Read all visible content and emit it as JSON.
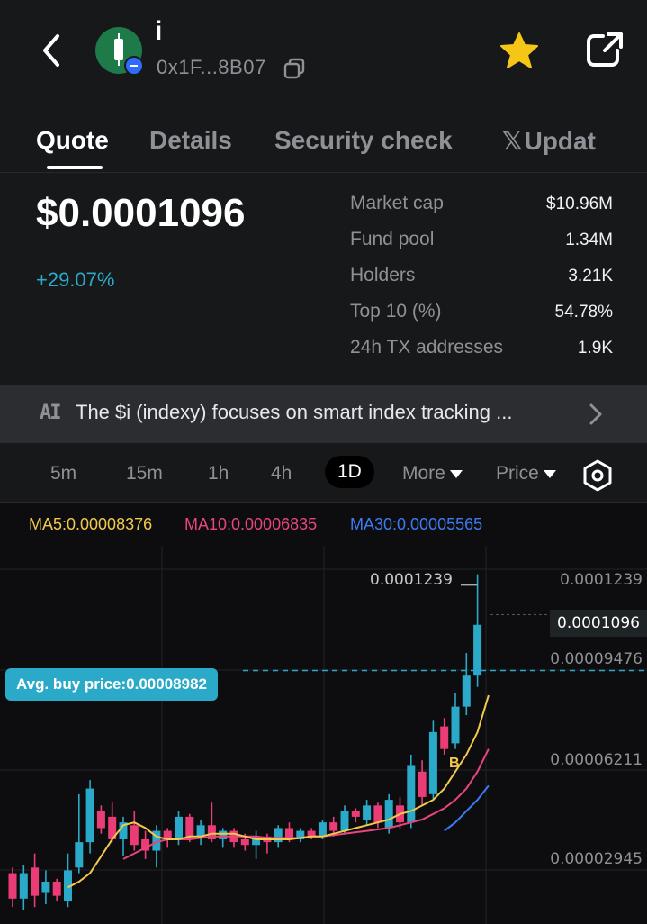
{
  "header": {
    "token_symbol": "i",
    "address": "0x1F...8B07"
  },
  "tabs": [
    {
      "label": "Quote",
      "active": true
    },
    {
      "label": "Details",
      "active": false
    },
    {
      "label": "Security check",
      "active": false
    },
    {
      "label": "Updat",
      "active": false
    }
  ],
  "quote": {
    "price": "$0.0001096",
    "change": "+29.07%",
    "stats": [
      {
        "label": "Market cap",
        "value": "$10.96M"
      },
      {
        "label": "Fund pool",
        "value": "1.34M"
      },
      {
        "label": "Holders",
        "value": "3.21K"
      },
      {
        "label": "Top 10 (%)",
        "value": "54.78%"
      },
      {
        "label": "24h TX addresses",
        "value": "1.9K"
      }
    ]
  },
  "ai_summary": {
    "icon_text": "AI",
    "text": "The $i (indexy) focuses on smart index tracking ..."
  },
  "timeframes": [
    "5m",
    "15m",
    "1h",
    "4h",
    "1D"
  ],
  "timeframe_active": "1D",
  "dropdowns": {
    "more": "More",
    "price": "Price"
  },
  "ma": {
    "ma5": "MA5:0.00008376",
    "ma10": "MA10:0.00006835",
    "ma30": "MA30:0.00005565"
  },
  "colors": {
    "up": "#2aa9c9",
    "down": "#ea3d78",
    "ma5": "#f2c94c",
    "ma10": "#e8457c",
    "ma30": "#3d7bf2",
    "star": "#f5c518",
    "brand": "#1f7a4a"
  },
  "chart_data": {
    "type": "candlestick",
    "y_axis_labels": [
      "0.0001239",
      "0.00009476",
      "0.00006211",
      "0.00002945"
    ],
    "current_price_label": "0.0001096",
    "high_label": "0.0001239",
    "avg_buy_price_label": "Avg. buy price:0.00008982",
    "marker_label": "B",
    "avg_buy_price": 8.982e-05,
    "current_price": 0.0001096,
    "ylim": [
      0.0,
      0.000134
    ],
    "candles": [
      {
        "o": 1.8e-05,
        "c": 9e-06,
        "h": 2e-05,
        "l": 6e-06
      },
      {
        "o": 9e-06,
        "c": 1.8e-05,
        "h": 2.1e-05,
        "l": 5e-06
      },
      {
        "o": 2e-05,
        "c": 1e-05,
        "h": 2.5e-05,
        "l": 6e-06
      },
      {
        "o": 1.1e-05,
        "c": 1.5e-05,
        "h": 1.9e-05,
        "l": 7e-06
      },
      {
        "o": 1.5e-05,
        "c": 1e-05,
        "h": 1.6e-05,
        "l": 8e-06
      },
      {
        "o": 8e-06,
        "c": 1.9e-05,
        "h": 2.5e-05,
        "l": 6e-06
      },
      {
        "o": 2e-05,
        "c": 2.9e-05,
        "h": 4.6e-05,
        "l": 1.8e-05
      },
      {
        "o": 2.9e-05,
        "c": 4.8e-05,
        "h": 5.1e-05,
        "l": 2.5e-05
      },
      {
        "o": 4e-05,
        "c": 3.4e-05,
        "h": 4.2e-05,
        "l": 3.2e-05
      },
      {
        "o": 3.8e-05,
        "c": 3e-05,
        "h": 4.3e-05,
        "l": 2.9e-05
      },
      {
        "o": 3e-05,
        "c": 3.6e-05,
        "h": 3.8e-05,
        "l": 2.4e-05
      },
      {
        "o": 3.5e-05,
        "c": 2.8e-05,
        "h": 4e-05,
        "l": 2.6e-05
      },
      {
        "o": 3e-05,
        "c": 2.6e-05,
        "h": 3.3e-05,
        "l": 2.3e-05
      },
      {
        "o": 2.6e-05,
        "c": 3.3e-05,
        "h": 3.5e-05,
        "l": 2e-05
      },
      {
        "o": 3.3e-05,
        "c": 3e-05,
        "h": 3.4e-05,
        "l": 2.7e-05
      },
      {
        "o": 3e-05,
        "c": 3.8e-05,
        "h": 4e-05,
        "l": 2.8e-05
      },
      {
        "o": 3.8e-05,
        "c": 3.1e-05,
        "h": 3.9e-05,
        "l": 2.9e-05
      },
      {
        "o": 3.1e-05,
        "c": 3.5e-05,
        "h": 3.7e-05,
        "l": 2.8e-05
      },
      {
        "o": 3.5e-05,
        "c": 3e-05,
        "h": 4.3e-05,
        "l": 2.9e-05
      },
      {
        "o": 3e-05,
        "c": 3.3e-05,
        "h": 3.4e-05,
        "l": 2.7e-05
      },
      {
        "o": 3.3e-05,
        "c": 2.9e-05,
        "h": 3.4e-05,
        "l": 2.7e-05
      },
      {
        "o": 3e-05,
        "c": 2.8e-05,
        "h": 3.2e-05,
        "l": 2.6e-05
      },
      {
        "o": 2.8e-05,
        "c": 3.1e-05,
        "h": 3.3e-05,
        "l": 2.3e-05
      },
      {
        "o": 3.1e-05,
        "c": 2.9e-05,
        "h": 3.2e-05,
        "l": 2.5e-05
      },
      {
        "o": 2.9e-05,
        "c": 3.4e-05,
        "h": 3.5e-05,
        "l": 2.7e-05
      },
      {
        "o": 3.4e-05,
        "c": 3e-05,
        "h": 3.6e-05,
        "l": 2.9e-05
      },
      {
        "o": 3e-05,
        "c": 3.3e-05,
        "h": 3.4e-05,
        "l": 2.9e-05
      },
      {
        "o": 3.3e-05,
        "c": 3.1e-05,
        "h": 3.4e-05,
        "l": 3e-05
      },
      {
        "o": 3.1e-05,
        "c": 3.6e-05,
        "h": 3.7e-05,
        "l": 3e-05
      },
      {
        "o": 3.6e-05,
        "c": 3.3e-05,
        "h": 3.8e-05,
        "l": 3.1e-05
      },
      {
        "o": 3.3e-05,
        "c": 4e-05,
        "h": 4.2e-05,
        "l": 3.2e-05
      },
      {
        "o": 4e-05,
        "c": 3.8e-05,
        "h": 4.1e-05,
        "l": 3.6e-05
      },
      {
        "o": 3.7e-05,
        "c": 4.2e-05,
        "h": 4.4e-05,
        "l": 3.5e-05
      },
      {
        "o": 4.2e-05,
        "c": 3.6e-05,
        "h": 4.3e-05,
        "l": 3.4e-05
      },
      {
        "o": 3.4e-05,
        "c": 4.4e-05,
        "h": 4.6e-05,
        "l": 3.2e-05
      },
      {
        "o": 4.2e-05,
        "c": 3.6e-05,
        "h": 4.5e-05,
        "l": 3.4e-05
      },
      {
        "o": 3.6e-05,
        "c": 5.6e-05,
        "h": 6e-05,
        "l": 3.4e-05
      },
      {
        "o": 5.4e-05,
        "c": 4.5e-05,
        "h": 5.8e-05,
        "l": 4.2e-05
      },
      {
        "o": 4.6e-05,
        "c": 6.8e-05,
        "h": 7.2e-05,
        "l": 4.4e-05
      },
      {
        "o": 7e-05,
        "c": 6.2e-05,
        "h": 7.3e-05,
        "l": 6e-05
      },
      {
        "o": 6.4e-05,
        "c": 7.7e-05,
        "h": 8.2e-05,
        "l": 6.2e-05
      },
      {
        "o": 7.7e-05,
        "c": 8.8e-05,
        "h": 9.6e-05,
        "l": 7.4e-05
      },
      {
        "o": 8.8e-05,
        "c": 0.000106,
        "h": 0.0001239,
        "l": 8.4e-05
      }
    ],
    "ma5_series": [
      null,
      null,
      null,
      null,
      1.3e-05,
      1.5e-05,
      1.8e-05,
      2.4e-05,
      3e-05,
      3.5e-05,
      3.6e-05,
      3.4e-05,
      3.1e-05,
      3e-05,
      3e-05,
      3.1e-05,
      3.1e-05,
      3.2e-05,
      3.2e-05,
      3.2e-05,
      3.1e-05,
      3e-05,
      3e-05,
      3e-05,
      3e-05,
      3.05e-05,
      3.1e-05,
      3.1e-05,
      3.2e-05,
      3.3e-05,
      3.4e-05,
      3.5e-05,
      3.6e-05,
      3.7e-05,
      3.9e-05,
      4e-05,
      4.2e-05,
      4.4e-05,
      4.8e-05,
      5.4e-05,
      6e-05,
      6.8e-05,
      8.1e-05
    ],
    "ma10_series": [
      null,
      null,
      null,
      null,
      null,
      null,
      null,
      null,
      null,
      2.3e-05,
      2.5e-05,
      2.7e-05,
      2.9e-05,
      3e-05,
      3e-05,
      3e-05,
      3.05e-05,
      3.1e-05,
      3.1e-05,
      3.1e-05,
      3.1e-05,
      3.1e-05,
      3.05e-05,
      3.05e-05,
      3.05e-05,
      3.05e-05,
      3.1e-05,
      3.1e-05,
      3.15e-05,
      3.2e-05,
      3.25e-05,
      3.3e-05,
      3.35e-05,
      3.4e-05,
      3.5e-05,
      3.6e-05,
      3.7e-05,
      3.9e-05,
      4.1e-05,
      4.4e-05,
      4.8e-05,
      5.4e-05,
      6.2e-05
    ],
    "ma30_series": [
      null,
      null,
      null,
      null,
      null,
      null,
      null,
      null,
      null,
      null,
      null,
      null,
      null,
      null,
      null,
      null,
      null,
      null,
      null,
      null,
      null,
      null,
      null,
      null,
      null,
      null,
      null,
      null,
      null,
      null,
      null,
      null,
      null,
      null,
      null,
      null,
      null,
      null,
      3.3e-05,
      3.6e-05,
      4e-05,
      4.4e-05,
      4.9e-05
    ]
  }
}
